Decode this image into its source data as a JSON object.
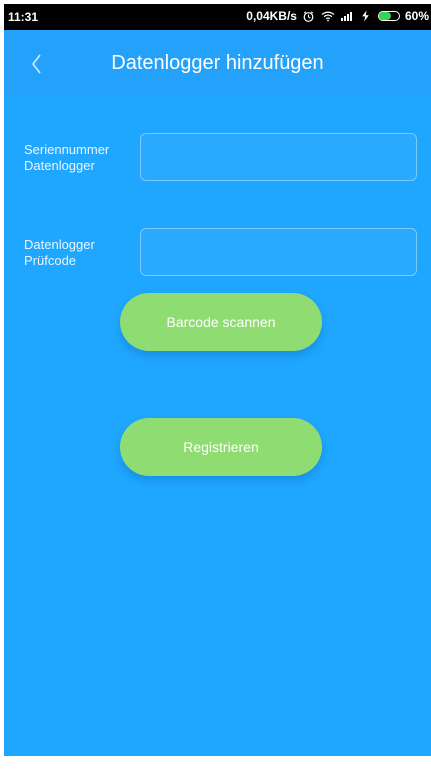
{
  "status_bar": {
    "time": "11:31",
    "network_speed": "0,04KB/s",
    "battery_text": "60%",
    "battery_level": 60,
    "icons": [
      "alarm-icon",
      "wifi-icon",
      "signal-icon",
      "charging-icon",
      "battery-icon"
    ]
  },
  "header": {
    "title": "Datenlogger hinzufügen",
    "back_icon": "chevron-left-icon"
  },
  "form": {
    "serial_label": "Seriennummer\nDatenlogger",
    "serial_value": "",
    "serial_placeholder": "",
    "check_label": "Datenlogger\nPrüfcode",
    "check_value": "",
    "check_placeholder": ""
  },
  "buttons": {
    "scan_label": "Barcode scannen",
    "register_label": "Registrieren"
  },
  "colors": {
    "background": "#1fa6fe",
    "header": "#24a2fb",
    "button": "#8fdd72",
    "text": "#ffffff"
  }
}
